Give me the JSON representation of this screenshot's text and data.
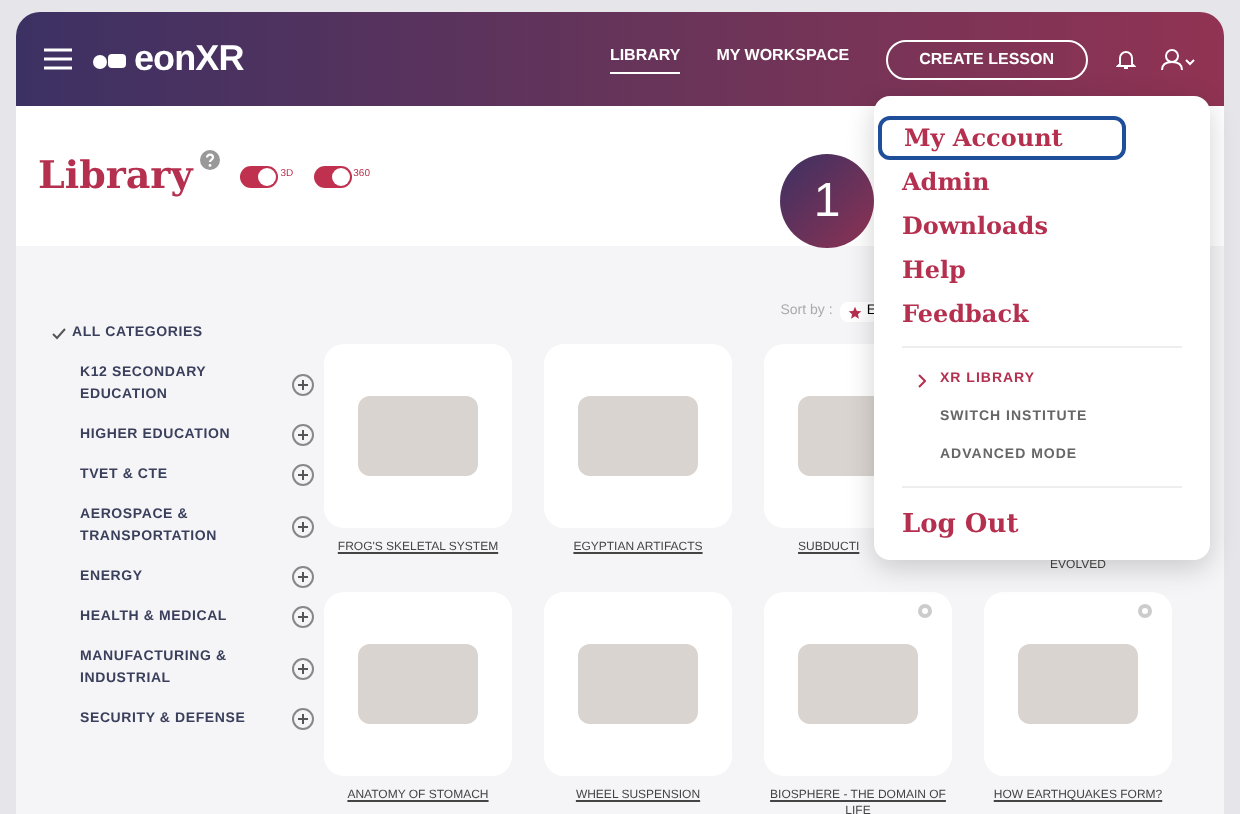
{
  "header": {
    "logo": "eonXR",
    "nav": [
      {
        "label": "LIBRARY",
        "selected": true
      },
      {
        "label": "MY WORKSPACE",
        "selected": false
      }
    ],
    "cta": "CREATE LESSON"
  },
  "page": {
    "title": "Library",
    "toggles": [
      {
        "label": "3D",
        "on": true
      },
      {
        "label": "360",
        "on": true
      }
    ]
  },
  "sort": {
    "label": "Sort by :",
    "value": "E"
  },
  "categories": [
    {
      "label": "ALL CATEGORIES",
      "selected": true
    },
    {
      "label": "K12 SECONDARY EDUCATION",
      "selected": false
    },
    {
      "label": "HIGHER EDUCATION",
      "selected": false
    },
    {
      "label": "TVET & CTE",
      "selected": false
    },
    {
      "label": "AEROSPACE & TRANSPORTATION",
      "selected": false
    },
    {
      "label": "ENERGY",
      "selected": false
    },
    {
      "label": "HEALTH & MEDICAL",
      "selected": false
    },
    {
      "label": "MANUFACTURING & INDUSTRIAL",
      "selected": false
    },
    {
      "label": "SECURITY & DEFENSE",
      "selected": false
    }
  ],
  "cards": [
    {
      "kind": "card",
      "title": "FROG'S SKELETAL SYSTEM",
      "dot": false
    },
    {
      "kind": "card",
      "title": "EGYPTIAN ARTIFACTS",
      "dot": false
    },
    {
      "kind": "cut",
      "title": "SUBDUCTI"
    },
    {
      "kind": "title_only",
      "title": "EVOLVED"
    },
    {
      "kind": "card",
      "title": "ANATOMY OF STOMACH",
      "dot": false
    },
    {
      "kind": "card",
      "title": "WHEEL SUSPENSION",
      "dot": false
    },
    {
      "kind": "card",
      "title": "BIOSPHERE - THE DOMAIN OF LIFE",
      "dot": true
    },
    {
      "kind": "card",
      "title": "HOW EARTHQUAKES FORM?",
      "dot": true
    }
  ],
  "menu": {
    "items": [
      {
        "label": "My Account",
        "highlighted": true
      },
      {
        "label": "Admin",
        "highlighted": false
      },
      {
        "label": "Downloads",
        "highlighted": false
      },
      {
        "label": "Help",
        "highlighted": false
      },
      {
        "label": "Feedback",
        "highlighted": false
      }
    ],
    "modes": [
      {
        "label": "XR LIBRARY",
        "selected": true
      },
      {
        "label": "SWITCH INSTITUTE",
        "selected": false
      },
      {
        "label": "ADVANCED MODE",
        "selected": false
      }
    ],
    "logout": "Log Out"
  },
  "step_badge": "1"
}
